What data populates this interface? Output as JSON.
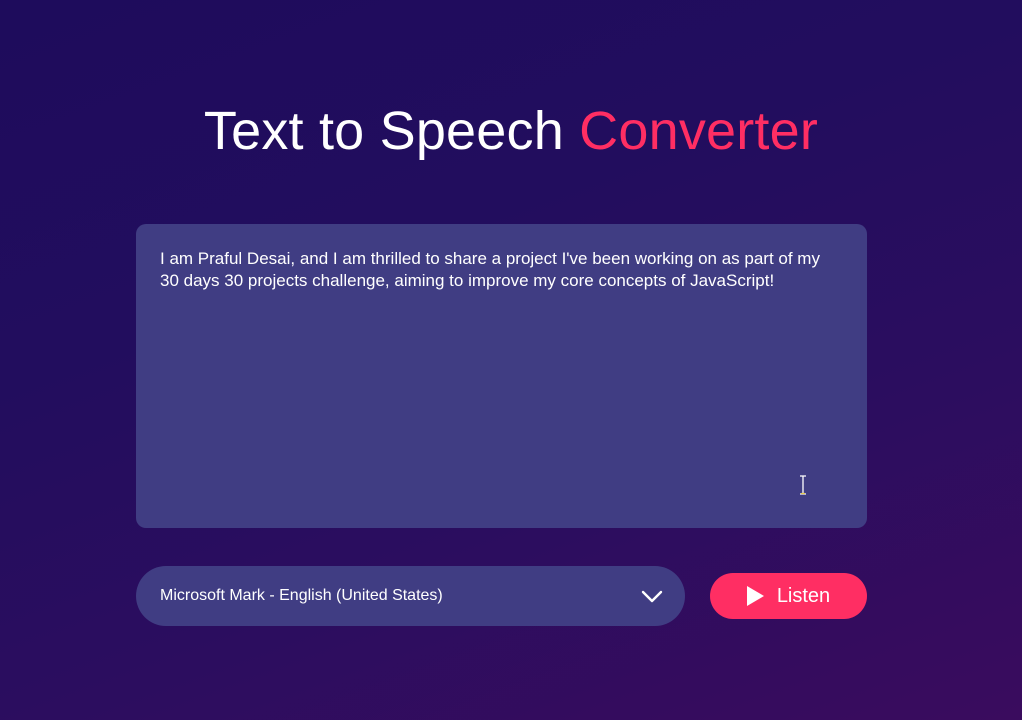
{
  "header": {
    "title_main": "Text to Speech",
    "title_accent": "Converter"
  },
  "editor": {
    "text": "I am Praful Desai, and I am thrilled to share a project I've been working on as part of my 30 days 30 projects challenge, aiming to improve my core concepts of JavaScript!"
  },
  "controls": {
    "voice_selected": "Microsoft Mark - English (United States)",
    "listen_label": "Listen"
  },
  "icons": {
    "dropdown": "chevron-down-icon",
    "listen": "play-icon",
    "cursor": "text-cursor-icon"
  },
  "colors": {
    "accent": "#ff2e63",
    "panel": "#403d83",
    "background": "#220d5e"
  }
}
